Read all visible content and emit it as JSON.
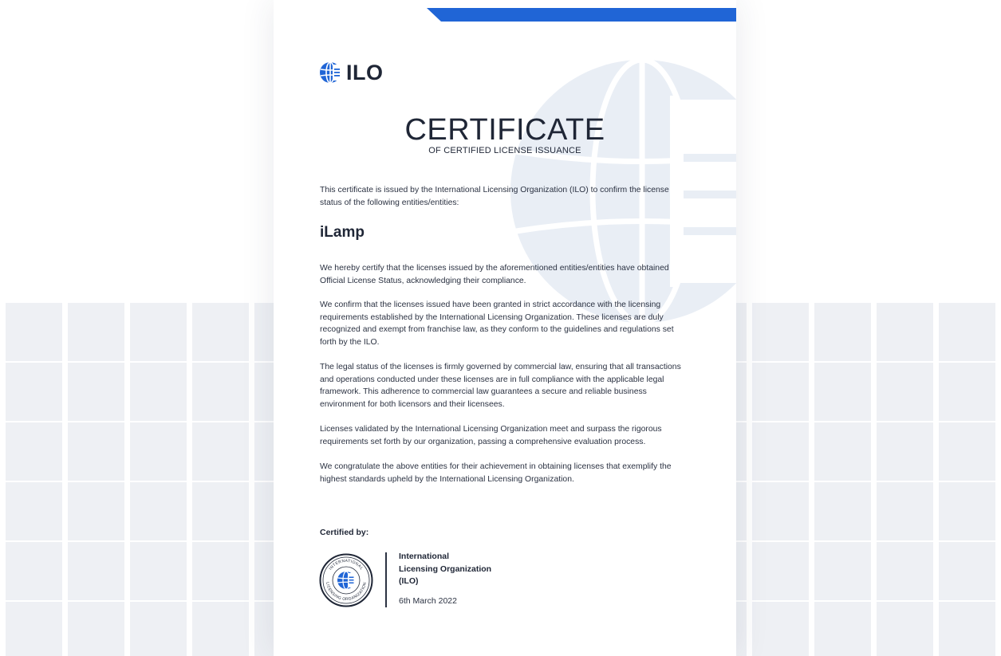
{
  "brand": {
    "logo_text": "ILO",
    "accent_color": "#2065d6",
    "text_color": "#1f2636"
  },
  "certificate": {
    "title": "CERTIFICATE",
    "subtitle": "OF CERTIFIED LICENSE ISSUANCE",
    "intro": "This certificate is issued by the International Licensing Organization (ILO) to confirm the license status of the following entities/entities:",
    "entity_name": "iLamp",
    "paragraphs": [
      "We hereby certify that the licenses issued by the aforementioned entities/entities have obtained Official License Status, acknowledging their compliance.",
      "We confirm that the licenses issued have been granted in strict accordance with the licensing requirements established by the International Licensing Organization. These licenses are duly recognized and exempt from franchise law, as they conform to the guidelines and regulations set forth by the ILO.",
      "The legal status of the licenses is firmly governed by commercial law, ensuring that all transactions and operations conducted under these licenses are in full compliance with the applicable legal framework. This adherence to commercial law guarantees a secure and reliable business environment for both licensors and their licensees.",
      "Licenses validated by the International Licensing Organization meet and surpass the rigorous requirements set forth by our organization, passing a comprehensive evaluation process.",
      "We congratulate the above entities for their achievement in obtaining licenses that exemplify the highest standards upheld by the International Licensing Organization."
    ],
    "certified_by_label": "Certified by:",
    "org_name_lines": [
      "International",
      "Licensing Organization",
      "(ILO)"
    ],
    "date": "6th March 2022",
    "seal_text_top": "INTERNATIONAL",
    "seal_text_bottom": "LICENSING ORGANIZATION"
  },
  "icons": {
    "logo": "globe-icon",
    "seal": "ilo-seal-icon",
    "watermark": "globe-watermark-icon"
  }
}
